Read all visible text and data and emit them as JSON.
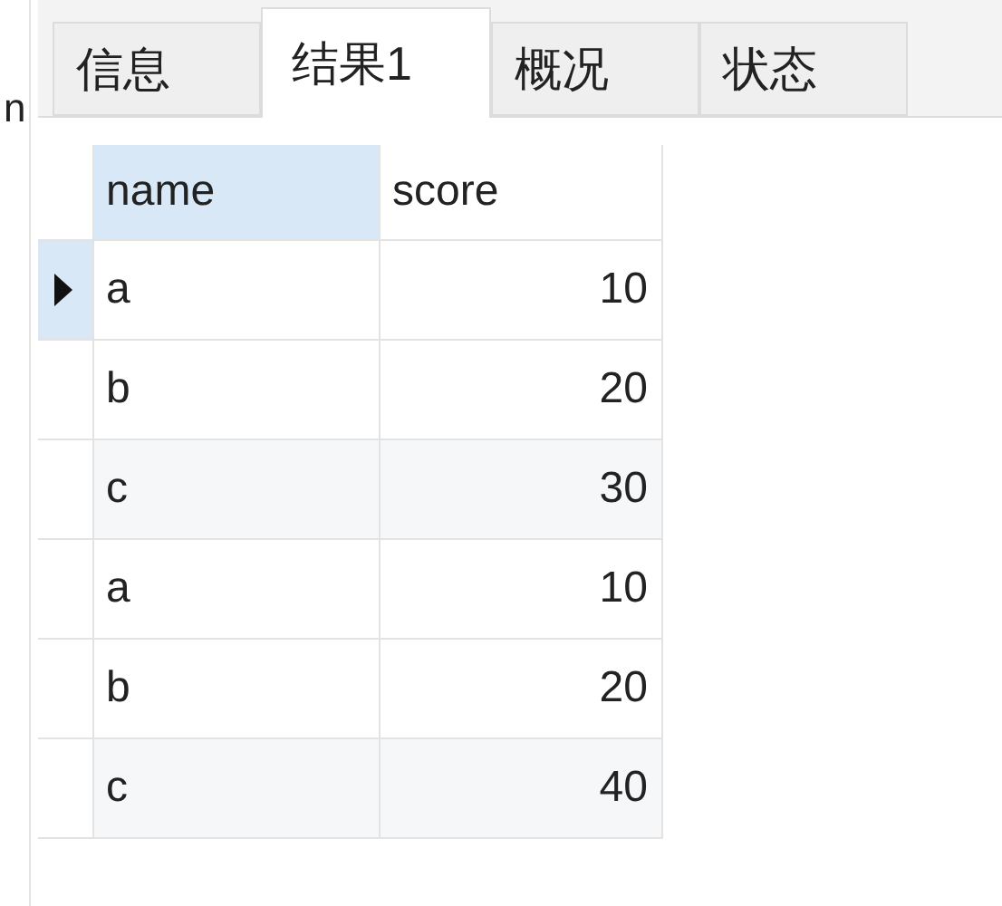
{
  "side_label": "n",
  "tabs": [
    {
      "label": "信息",
      "selected": false
    },
    {
      "label": "结果1",
      "selected": true
    },
    {
      "label": "概况",
      "selected": false
    },
    {
      "label": "状态",
      "selected": false
    }
  ],
  "table": {
    "columns": [
      {
        "label": "name",
        "selected": true,
        "kind": "text"
      },
      {
        "label": "score",
        "selected": false,
        "kind": "number"
      }
    ],
    "rows": [
      {
        "cells": [
          "a",
          "10"
        ],
        "selected": true
      },
      {
        "cells": [
          "b",
          "20"
        ],
        "selected": false
      },
      {
        "cells": [
          "c",
          "30"
        ],
        "selected": false
      },
      {
        "cells": [
          "a",
          "10"
        ],
        "selected": false
      },
      {
        "cells": [
          "b",
          "20"
        ],
        "selected": false
      },
      {
        "cells": [
          "c",
          "40"
        ],
        "selected": false
      }
    ]
  }
}
